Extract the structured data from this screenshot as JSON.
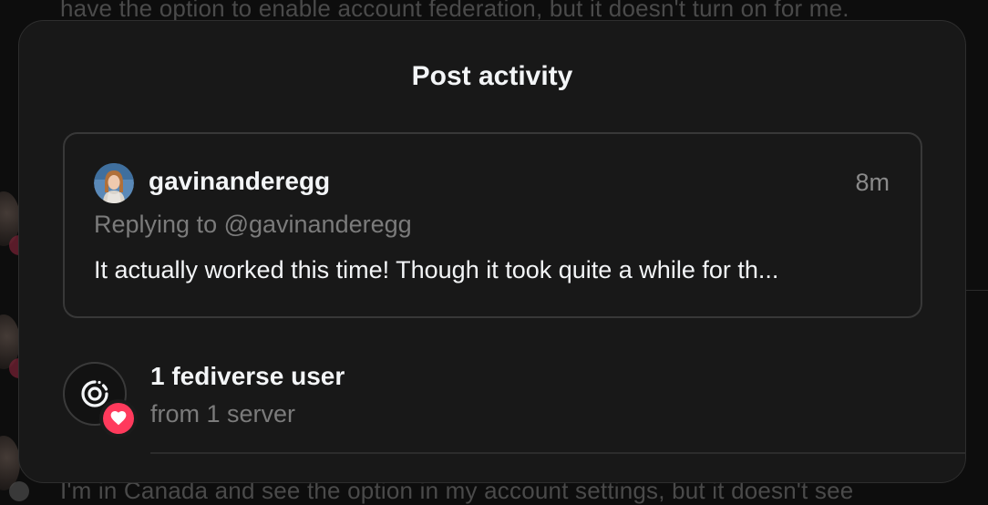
{
  "background": {
    "top_text": "have the option to enable account federation, but it doesn't turn on for me.",
    "bottom_text": "I'm in Canada and see the option in my account settings, but it doesn't see"
  },
  "dialog": {
    "title": "Post activity"
  },
  "post": {
    "username": "gavinanderegg",
    "timestamp": "8m",
    "replying_to": "Replying to @gavinanderegg",
    "text": "It actually worked this time! Though it took quite a while for th..."
  },
  "activity": {
    "title": "1 fediverse user",
    "subtitle": "from 1 server",
    "icon": "fediverse-icon",
    "badge_icon": "heart-icon"
  },
  "colors": {
    "accent_like": "#ff3a5c",
    "sheet_bg": "#181818",
    "primary_text": "#f3f5f7",
    "secondary_text": "#7b7b7b"
  }
}
